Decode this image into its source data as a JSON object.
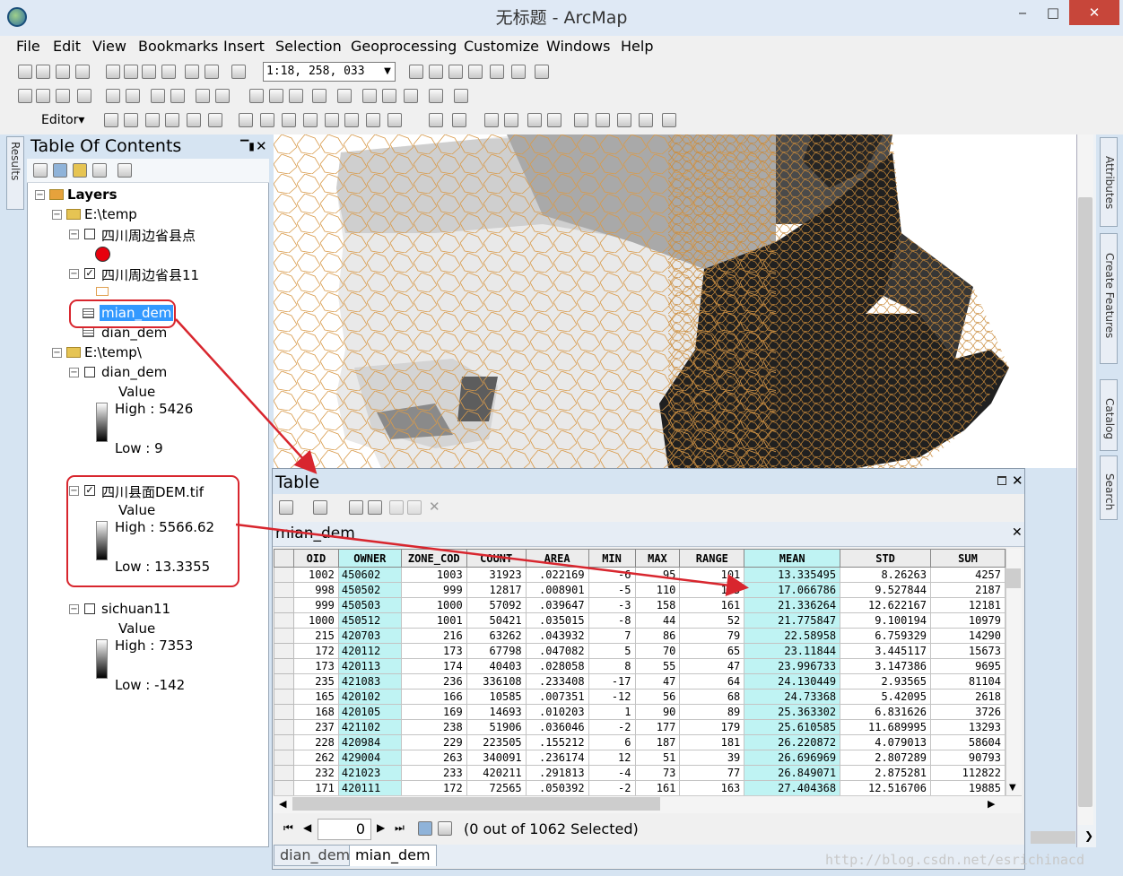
{
  "window": {
    "title": "无标题 - ArcMap",
    "minimize": "‒",
    "maximize": "□",
    "close": "✕"
  },
  "menu": [
    "File",
    "Edit",
    "View",
    "Bookmarks",
    "Insert",
    "Selection",
    "Geoprocessing",
    "Customize",
    "Windows",
    "Help"
  ],
  "toolbar": {
    "scale": "1:18, 258, 033",
    "editor_label": "Editor▾"
  },
  "left_rail": {
    "results_tab": "Results"
  },
  "right_rail": {
    "attributes_tab": "Attributes",
    "create_features_tab": "Create Features",
    "catalog_tab": "Catalog",
    "search_tab": "Search"
  },
  "toc": {
    "title": "Table Of Contents",
    "pin": "ᵖ",
    "close": "✕",
    "layers_label": "Layers",
    "folder1": "E:\\temp",
    "layer_points": "四川周边省县点",
    "layer_poly": "四川周边省县11",
    "table_selected": "mian_dem",
    "table_other": "dian_dem",
    "folder2": "E:\\temp\\",
    "raster1": {
      "name": "dian_dem",
      "value_label": "Value",
      "high": "High : 5426",
      "low": "Low : 9"
    },
    "raster2": {
      "name": "四川县面DEM.tif",
      "value_label": "Value",
      "high": "High : 5566.62",
      "low": "Low : 13.3355"
    },
    "raster3": {
      "name": "sichuan11",
      "value_label": "Value",
      "high": "High : 7353",
      "low": "Low : -142"
    }
  },
  "colors": {
    "point_symbol": "#e8000e",
    "callout": "#d8262e",
    "highlight_column": "#bff3f3",
    "selection": "#3399ff"
  },
  "table_window": {
    "title": "Table",
    "tab_name": "mian_dem",
    "columns": [
      "OID",
      "OWNER",
      "ZONE_COD",
      "COUNT",
      "AREA",
      "MIN",
      "MAX",
      "RANGE",
      "MEAN",
      "STD",
      "SUM"
    ],
    "rows": [
      [
        "1002",
        "450602",
        "1003",
        "31923",
        ".022169",
        "-6",
        "95",
        "101",
        "13.335495",
        "8.26263",
        "4257"
      ],
      [
        "998",
        "450502",
        "999",
        "12817",
        ".008901",
        "-5",
        "110",
        "115",
        "17.066786",
        "9.527844",
        "2187"
      ],
      [
        "999",
        "450503",
        "1000",
        "57092",
        ".039647",
        "-3",
        "158",
        "161",
        "21.336264",
        "12.622167",
        "12181"
      ],
      [
        "1000",
        "450512",
        "1001",
        "50421",
        ".035015",
        "-8",
        "44",
        "52",
        "21.775847",
        "9.100194",
        "10979"
      ],
      [
        "215",
        "420703",
        "216",
        "63262",
        ".043932",
        "7",
        "86",
        "79",
        "22.58958",
        "6.759329",
        "14290"
      ],
      [
        "172",
        "420112",
        "173",
        "67798",
        ".047082",
        "5",
        "70",
        "65",
        "23.11844",
        "3.445117",
        "15673"
      ],
      [
        "173",
        "420113",
        "174",
        "40403",
        ".028058",
        "8",
        "55",
        "47",
        "23.996733",
        "3.147386",
        "9695"
      ],
      [
        "235",
        "421083",
        "236",
        "336108",
        ".233408",
        "-17",
        "47",
        "64",
        "24.130449",
        "2.93565",
        "81104"
      ],
      [
        "165",
        "420102",
        "166",
        "10585",
        ".007351",
        "-12",
        "56",
        "68",
        "24.73368",
        "5.42095",
        "2618"
      ],
      [
        "168",
        "420105",
        "169",
        "14693",
        ".010203",
        "1",
        "90",
        "89",
        "25.363302",
        "6.831626",
        "3726"
      ],
      [
        "237",
        "421102",
        "238",
        "51906",
        ".036046",
        "-2",
        "177",
        "179",
        "25.610585",
        "11.689995",
        "13293"
      ],
      [
        "228",
        "420984",
        "229",
        "223505",
        ".155212",
        "6",
        "187",
        "181",
        "26.220872",
        "4.079013",
        "58604"
      ],
      [
        "262",
        "429004",
        "263",
        "340091",
        ".236174",
        "12",
        "51",
        "39",
        "26.696969",
        "2.807289",
        "90793"
      ],
      [
        "232",
        "421023",
        "233",
        "420211",
        ".291813",
        "-4",
        "73",
        "77",
        "26.849071",
        "2.875281",
        "112822"
      ],
      [
        "171",
        "420111",
        "172",
        "72565",
        ".050392",
        "-2",
        "161",
        "163",
        "27.404368",
        "12.516706",
        "19885"
      ]
    ],
    "record_number": "0",
    "selection_status": "(0 out of 1062 Selected)",
    "bottom_tabs": [
      "dian_dem",
      "mian_dem"
    ]
  },
  "watermark": "http://blog.csdn.net/esrichinacd"
}
